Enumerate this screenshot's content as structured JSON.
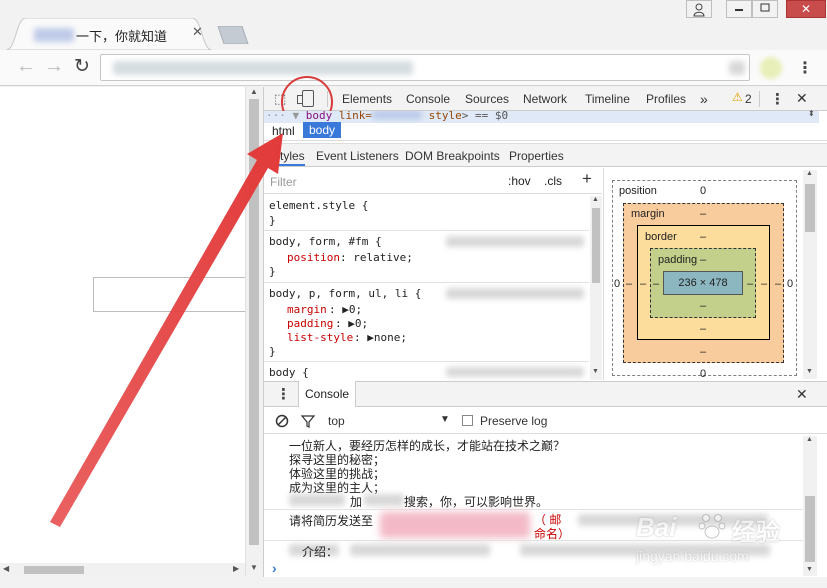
{
  "browser": {
    "tab_title": "一下，你就知道",
    "window_buttons": [
      "person",
      "minimize",
      "restore",
      "close"
    ]
  },
  "devtools": {
    "main_tabs": [
      "Elements",
      "Console",
      "Sources",
      "Network",
      "Timeline",
      "Profiles"
    ],
    "more": "»",
    "warning_count": "2",
    "close": "✕",
    "dom_line_body": "body",
    "dom_line_link": "link=",
    "dom_line_style": " style",
    "dom_line_suffix": "> == $0",
    "breadcrumbs": [
      "html",
      "body"
    ],
    "sub_tabs": [
      "Styles",
      "Event Listeners",
      "DOM Breakpoints",
      "Properties"
    ],
    "filter_placeholder": "Filter",
    "hov": ":hov",
    "cls": ".cls",
    "plus": "+",
    "rules": {
      "element_style": "element.style {",
      "rule1_selector": "body, form, #fm {",
      "rule1_prop": "position",
      "rule1_val": ": relative;",
      "rule2_selector": "body, p, form, ul, li {",
      "rule2_p1": "margin",
      "rule2_v1": ": ▶0;",
      "rule2_p2": "padding",
      "rule2_v2": ": ▶0;",
      "rule2_p3": "list-style",
      "rule2_v3": ": ▶none;",
      "rule3_selector": "body {",
      "close_brace": "}"
    },
    "box_model": {
      "position_label": "position",
      "position_value": "0",
      "margin_label": "margin",
      "margin_value": "–",
      "border_label": "border",
      "border_value": "–",
      "padding_label": "padding",
      "padding_value": "–",
      "content": "236 × 478",
      "side_value": "0",
      "dash": "–"
    }
  },
  "console": {
    "title": "Console",
    "context": "top",
    "preserve_log": "Preserve log",
    "lines": [
      "一位新人，要经历怎样的成长，才能站在技术之巅？",
      "探寻这里的秘密；",
      "体验这里的挑战；",
      "成为这里的主人；",
      "加",
      "搜索，你，可以影响世界。",
      "请将简历发送至",
      "（ 邮",
      "命名）",
      "介绍："
    ],
    "prompt": "›"
  },
  "watermark": {
    "brand": "Bai",
    "brand_2": "经验",
    "url": "jingyan.baidu.com"
  }
}
